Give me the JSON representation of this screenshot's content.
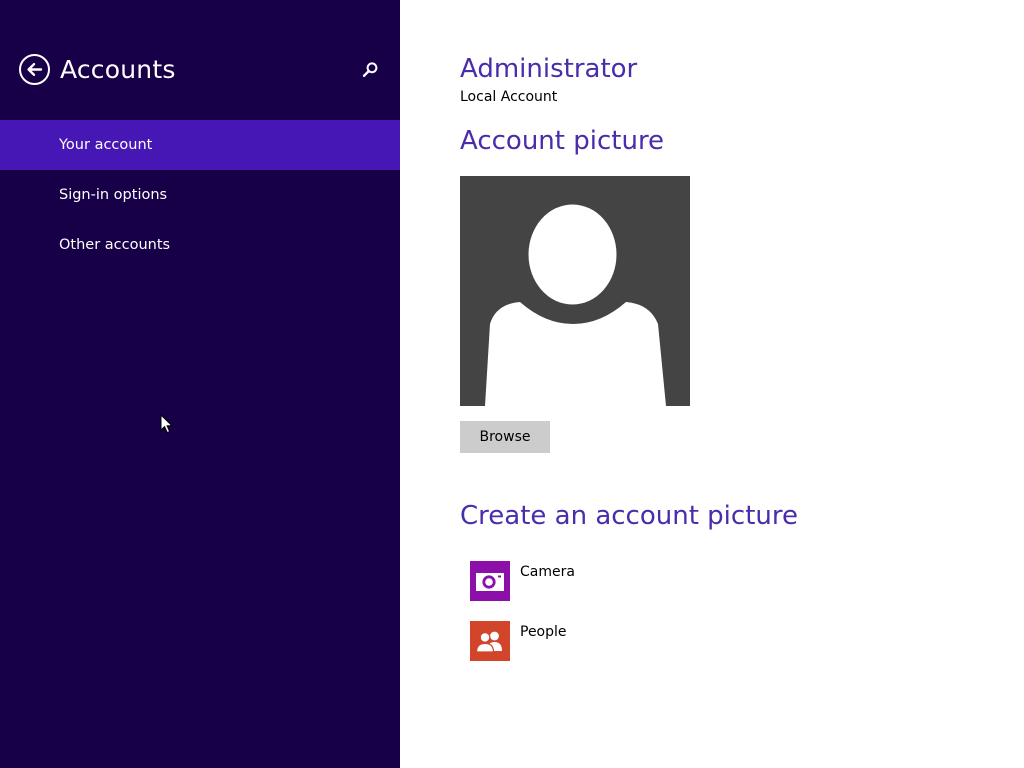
{
  "sidebar": {
    "title": "Accounts",
    "back_icon": "back-arrow-icon",
    "search_icon": "search-icon",
    "items": [
      {
        "label": "Your account",
        "selected": true
      },
      {
        "label": "Sign-in options",
        "selected": false
      },
      {
        "label": "Other accounts",
        "selected": false
      }
    ]
  },
  "main": {
    "account_name": "Administrator",
    "account_type": "Local Account",
    "picture_title": "Account picture",
    "avatar_icon": "default-user-silhouette",
    "browse_label": "Browse",
    "create_title": "Create an account picture",
    "apps": [
      {
        "label": "Camera",
        "icon": "camera-icon",
        "tile_color": "#8b0fa8"
      },
      {
        "label": "People",
        "icon": "people-icon",
        "tile_color": "#d2452b"
      }
    ]
  },
  "colors": {
    "sidebar_background": "#180048",
    "selected_item_background": "#4617b4",
    "heading_accent": "#4b2cab",
    "avatar_background": "#444444",
    "button_background": "#cccccc"
  }
}
